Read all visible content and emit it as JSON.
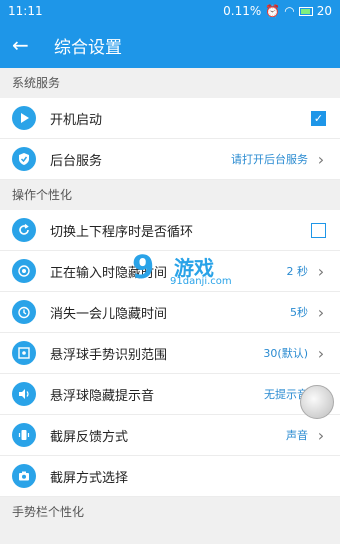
{
  "statusbar": {
    "time": "11:11",
    "speed": "0.11%",
    "battery": "20"
  },
  "appbar": {
    "title": "综合设置",
    "back_icon": "arrow-left-icon"
  },
  "sections": [
    {
      "header": "系统服务"
    },
    {
      "header": "操作个性化"
    },
    {
      "header": "手势栏个性化"
    }
  ],
  "rows": [
    {
      "label": "开机启动",
      "icon": "play-icon",
      "control": "checkbox",
      "checked": true
    },
    {
      "label": "后台服务",
      "icon": "shield-check-icon",
      "value": "请打开后台服务",
      "control": "chevron"
    },
    {
      "label": "切换上下程序时是否循环",
      "icon": "refresh-icon",
      "control": "checkbox",
      "checked": false
    },
    {
      "label": "正在输入时隐藏时间",
      "icon": "target-icon",
      "value": "2 秒",
      "control": "chevron"
    },
    {
      "label": "消失一会儿隐藏时间",
      "icon": "timer-icon",
      "value": "5秒",
      "control": "chevron"
    },
    {
      "label": "悬浮球手势识别范围",
      "icon": "expand-icon",
      "value": "30(默认)",
      "control": "chevron"
    },
    {
      "label": "悬浮球隐藏提示音",
      "icon": "volume-icon",
      "value": "无提示音",
      "control": "chevron"
    },
    {
      "label": "截屏反馈方式",
      "icon": "vibrate-icon",
      "value": "声音",
      "control": "chevron"
    },
    {
      "label": "截屏方式选择",
      "icon": "camera-icon",
      "control": "none"
    }
  ],
  "watermark": {
    "logo": "9",
    "text": "游戏",
    "url": "91danji.com"
  },
  "colors": {
    "primary": "#1e96e8",
    "icon_bg": "#2aa3e8",
    "value_text": "#2a8bd1"
  }
}
